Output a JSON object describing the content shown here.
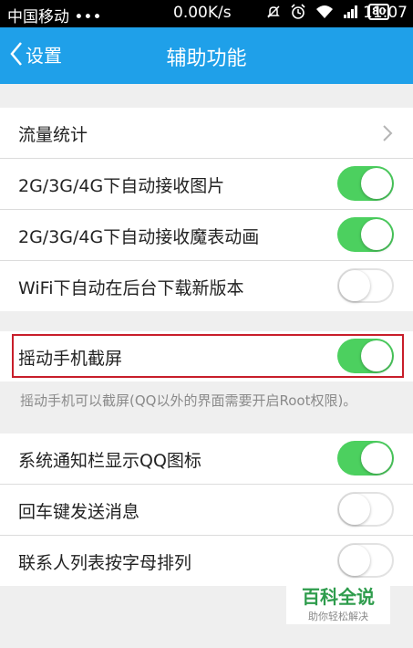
{
  "status_bar": {
    "carrier": "中国移动 •••",
    "speed": "0.00K/s",
    "battery": "80",
    "time": "11:07"
  },
  "title_bar": {
    "back_label": "设置",
    "title": "辅助功能"
  },
  "group1": {
    "items": [
      {
        "label": "流量统计",
        "control": "chevron"
      },
      {
        "label": "2G/3G/4G下自动接收图片",
        "control": "toggle",
        "on": true
      },
      {
        "label": "2G/3G/4G下自动接收魔表动画",
        "control": "toggle",
        "on": true
      },
      {
        "label": "WiFi下自动在后台下载新版本",
        "control": "toggle",
        "on": false
      }
    ]
  },
  "group2": {
    "items": [
      {
        "label": "摇动手机截屏",
        "control": "toggle",
        "on": true
      }
    ],
    "note": "摇动手机可以截屏(QQ以外的界面需要开启Root权限)。"
  },
  "group3": {
    "items": [
      {
        "label": "系统通知栏显示QQ图标",
        "control": "toggle",
        "on": true
      },
      {
        "label": "回车键发送消息",
        "control": "toggle",
        "on": false
      },
      {
        "label": "联系人列表按字母排列",
        "control": "toggle",
        "on": false
      }
    ]
  },
  "watermark": {
    "title": "百科全说",
    "subtitle": "助你轻松解决"
  },
  "colors": {
    "accent": "#1fa0e9",
    "toggle_on": "#4cd05f",
    "highlight": "#c81e2a"
  }
}
